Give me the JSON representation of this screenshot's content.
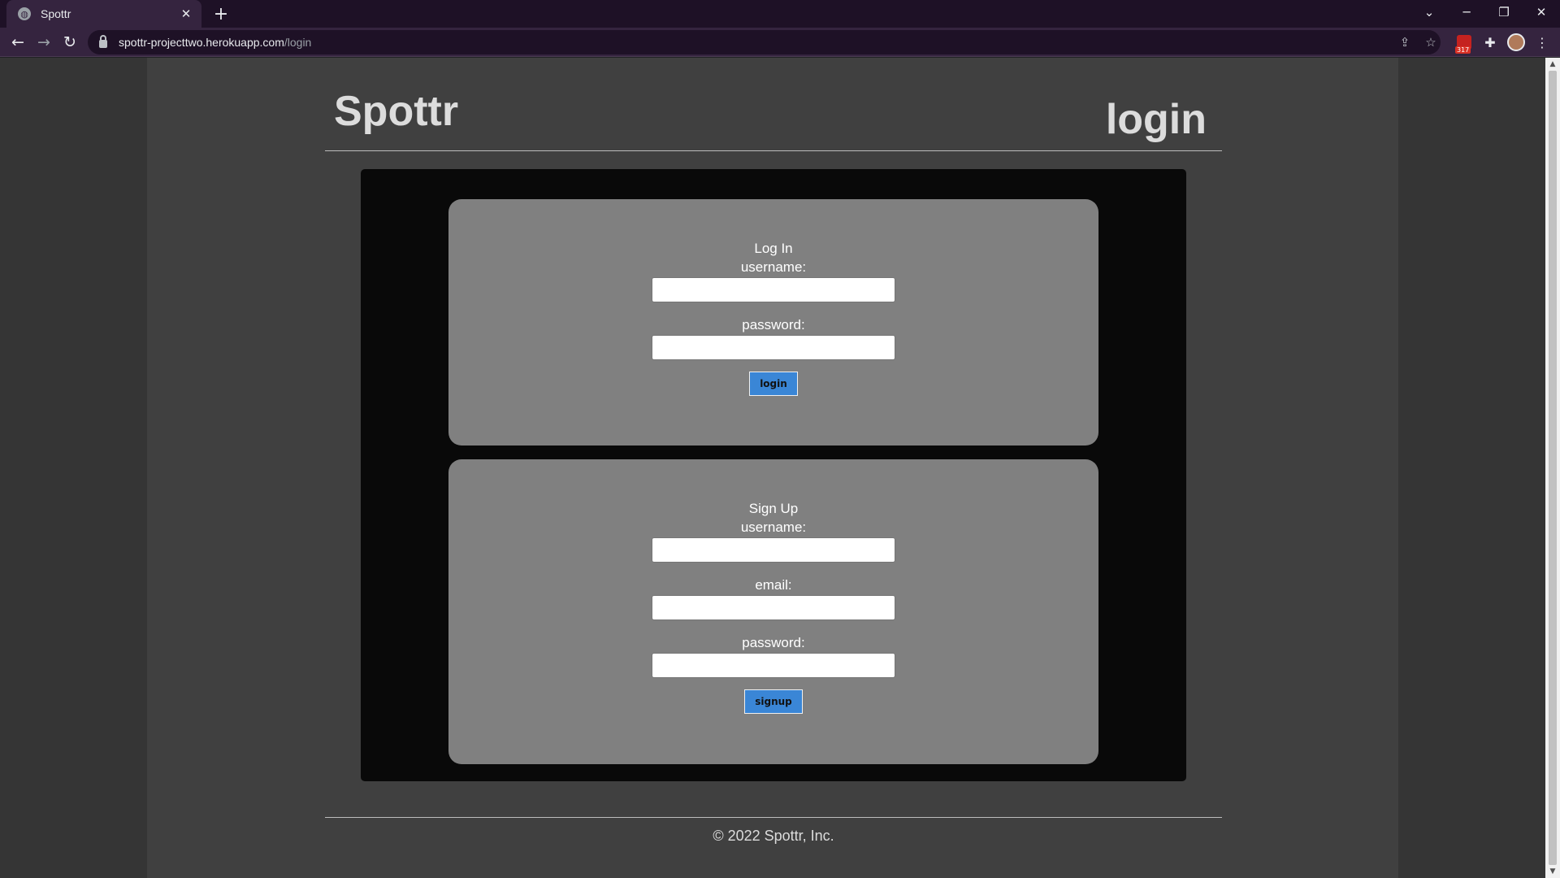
{
  "browser": {
    "tab_title": "Spottr",
    "tab_close_glyph": "✕",
    "new_tab_glyph": "+",
    "url_host": "spottr-projecttwo.herokuapp.com",
    "url_path": "/login",
    "extension_badge": "317"
  },
  "site": {
    "title": "Spottr",
    "page_heading": "login"
  },
  "login": {
    "title": "Log In",
    "username_label": "username:",
    "password_label": "password:",
    "submit_label": "login"
  },
  "signup": {
    "title": "Sign Up",
    "username_label": "username:",
    "email_label": "email:",
    "password_label": "password:",
    "submit_label": "signup"
  },
  "footer": {
    "text": "© 2022 Spottr, Inc."
  },
  "colors": {
    "button_accent": "#3a86d6",
    "card_bg": "#808080",
    "page_bg": "#404040"
  }
}
